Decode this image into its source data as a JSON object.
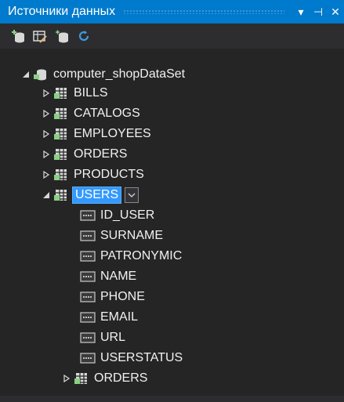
{
  "panel": {
    "title": "Источники данных",
    "controls": [
      "▾",
      "⊣",
      "✕"
    ]
  },
  "toolbar": {
    "icons": [
      "add-datasource-icon",
      "edit-dataset-icon",
      "add-query-icon",
      "refresh-icon"
    ]
  },
  "tree": {
    "dataset": "computer_shopDataSet",
    "tables": [
      {
        "label": "BILLS"
      },
      {
        "label": "CATALOGS"
      },
      {
        "label": "EMPLOYEES"
      },
      {
        "label": "ORDERS"
      },
      {
        "label": "PRODUCTS"
      }
    ],
    "users": {
      "label": "USERS",
      "fields": [
        "ID_USER",
        "SURNAME",
        "PATRONYMIC",
        "NAME",
        "PHONE",
        "EMAIL",
        "URL",
        "USERSTATUS"
      ],
      "child_table": "ORDERS"
    }
  },
  "colors": {
    "accent": "#007acc",
    "selection": "#3399ff",
    "background": "#252526",
    "text": "#f1f1f1"
  }
}
